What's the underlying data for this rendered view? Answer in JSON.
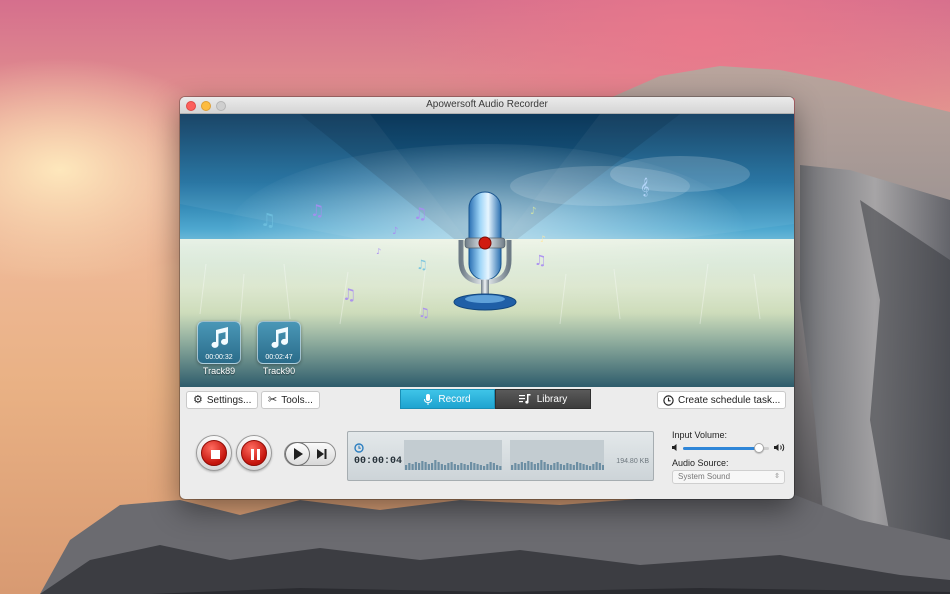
{
  "window": {
    "title": "Apowersoft Audio Recorder"
  },
  "tracks": [
    {
      "name": "Track89",
      "duration": "00:00:32"
    },
    {
      "name": "Track90",
      "duration": "00:02:47"
    }
  ],
  "toolbar": {
    "settings_label": "Settings...",
    "tools_label": "Tools...",
    "record_tab": "Record",
    "library_tab": "Library",
    "schedule_label": "Create schedule task..."
  },
  "recorder": {
    "elapsed": "00:00:04",
    "file_size": "194.80 KB",
    "status": "recording"
  },
  "audio": {
    "input_volume_label": "Input Volume:",
    "input_volume_level": 0.88,
    "source_label": "Audio Source:",
    "source_value": "System Sound"
  },
  "icons": {
    "settings": "gear-icon",
    "tools": "tools-icon",
    "record": "microphone-icon",
    "library": "music-list-icon",
    "schedule": "clock-icon",
    "stop": "stop-icon",
    "pause": "pause-icon",
    "play": "play-icon",
    "skip": "skip-forward-icon",
    "timer": "timer-icon",
    "volume_low": "speaker-low-icon",
    "volume_high": "speaker-high-icon"
  },
  "colors": {
    "accent": "#1ea3d0",
    "record_red": "#d01a10",
    "library_dark": "#454545"
  }
}
